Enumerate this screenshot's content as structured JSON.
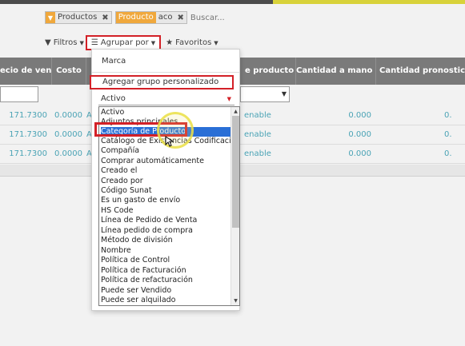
{
  "search": {
    "facets": [
      {
        "label": "Productos",
        "value": ""
      },
      {
        "label": "Producto",
        "value": "aco"
      }
    ],
    "placeholder": "Buscar..."
  },
  "toolbar": {
    "filters_label": "Filtros",
    "groupby_label": "Agrupar por",
    "favorites_label": "Favoritos"
  },
  "table": {
    "columns": [
      "ecio de venta",
      "Costo",
      "e producto",
      "Cantidad a mano",
      "Cantidad pronostic"
    ],
    "rows": [
      {
        "price": "171.7300",
        "cost": "0.0000",
        "name": "A",
        "type": "enable",
        "onhand": "0.000",
        "forecast": "0."
      },
      {
        "price": "171.7300",
        "cost": "0.0000",
        "name": "AC",
        "type": "enable",
        "onhand": "0.000",
        "forecast": "0."
      },
      {
        "price": "171.7300",
        "cost": "0.0000",
        "name": "ACO",
        "type": "enable",
        "onhand": "0.000",
        "forecast": "0."
      }
    ]
  },
  "groupby_menu": {
    "option_marca": "Marca",
    "custom_group_label": "Agregar grupo personalizado",
    "select_value": "Activo",
    "options": [
      "Activo",
      "Adjuntos principales",
      "Categoría de Producto",
      "Catálogo de Existencias Codificación",
      "Compañía",
      "Comprar automáticamente",
      "Creado el",
      "Creado por",
      "Código Sunat",
      "Es un gasto de envío",
      "HS Code",
      "Línea de Pedido de Venta",
      "Línea pedido de compra",
      "Método de división",
      "Nombre",
      "Política de Control",
      "Política de Facturación",
      "Política de refacturación",
      "Puede ser Vendido",
      "Puede ser alquilado"
    ],
    "selected_option": "Categoría de Producto"
  },
  "colors": {
    "accent": "#f0a83c",
    "annotation": "#d32027",
    "selection": "#2a6fd6",
    "header": "#7a7a7a"
  }
}
